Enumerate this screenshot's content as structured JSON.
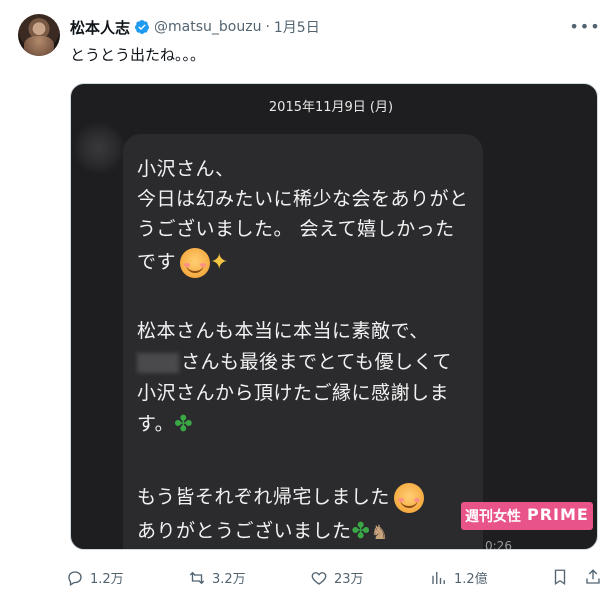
{
  "author": {
    "display_name": "松本人志",
    "handle": "@matsu_bouzu",
    "separator": "·",
    "date": "1月5日"
  },
  "tweet": {
    "text": "とうとう出たね。。。"
  },
  "media": {
    "date_header": "2015年11月9日 (月)",
    "lines": [
      "小沢さん、",
      "今日は幻みたいに稀少な会をありがと",
      "うございました。 会えて嬉しかった",
      "です",
      "松本さんも本当に本当に素敵で、",
      "さんも最後までとても優しくて",
      "小沢さんから頂けたご縁に感謝しま",
      "す。",
      "もう皆それぞれ帰宅しました",
      "ありがとうございました"
    ],
    "watermark_left": "週刊女性",
    "watermark_right": "PRIME",
    "timestamp": "0:26"
  },
  "actions": {
    "replies": "1.2万",
    "reposts": "3.2万",
    "likes": "23万",
    "views": "1.2億"
  },
  "colors": {
    "verified": "#1d9bf0",
    "secondary_text": "#536471"
  }
}
